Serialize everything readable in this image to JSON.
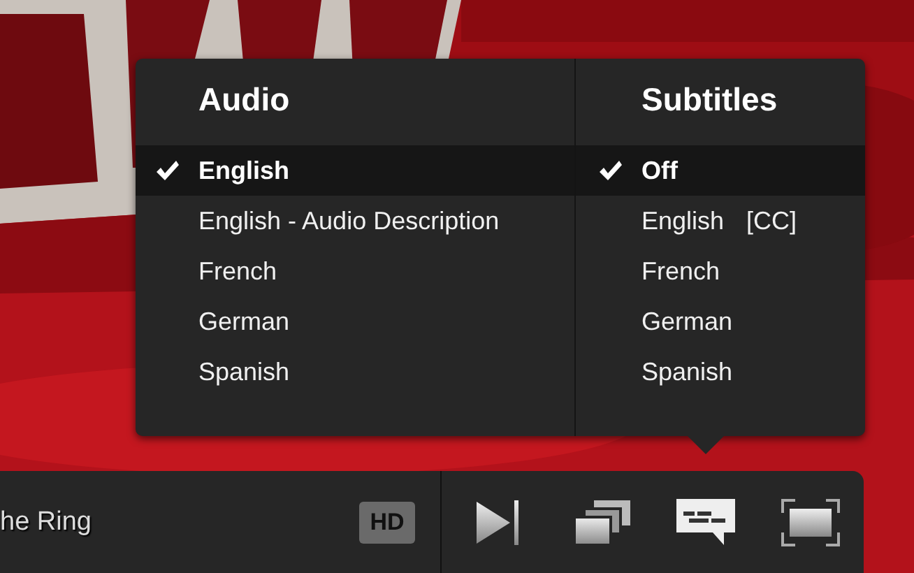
{
  "audio": {
    "title": "Audio",
    "options": [
      {
        "label": "English",
        "selected": true
      },
      {
        "label": "English - Audio Description",
        "selected": false
      },
      {
        "label": "French",
        "selected": false
      },
      {
        "label": "German",
        "selected": false
      },
      {
        "label": "Spanish",
        "selected": false
      }
    ]
  },
  "subtitles": {
    "title": "Subtitles",
    "options": [
      {
        "label": "Off",
        "selected": true
      },
      {
        "label": "English",
        "tag": "[CC]",
        "selected": false
      },
      {
        "label": "French",
        "selected": false
      },
      {
        "label": "German",
        "selected": false
      },
      {
        "label": "Spanish",
        "selected": false
      }
    ]
  },
  "player_bar": {
    "title": "he Ring",
    "hd_badge": "HD"
  }
}
